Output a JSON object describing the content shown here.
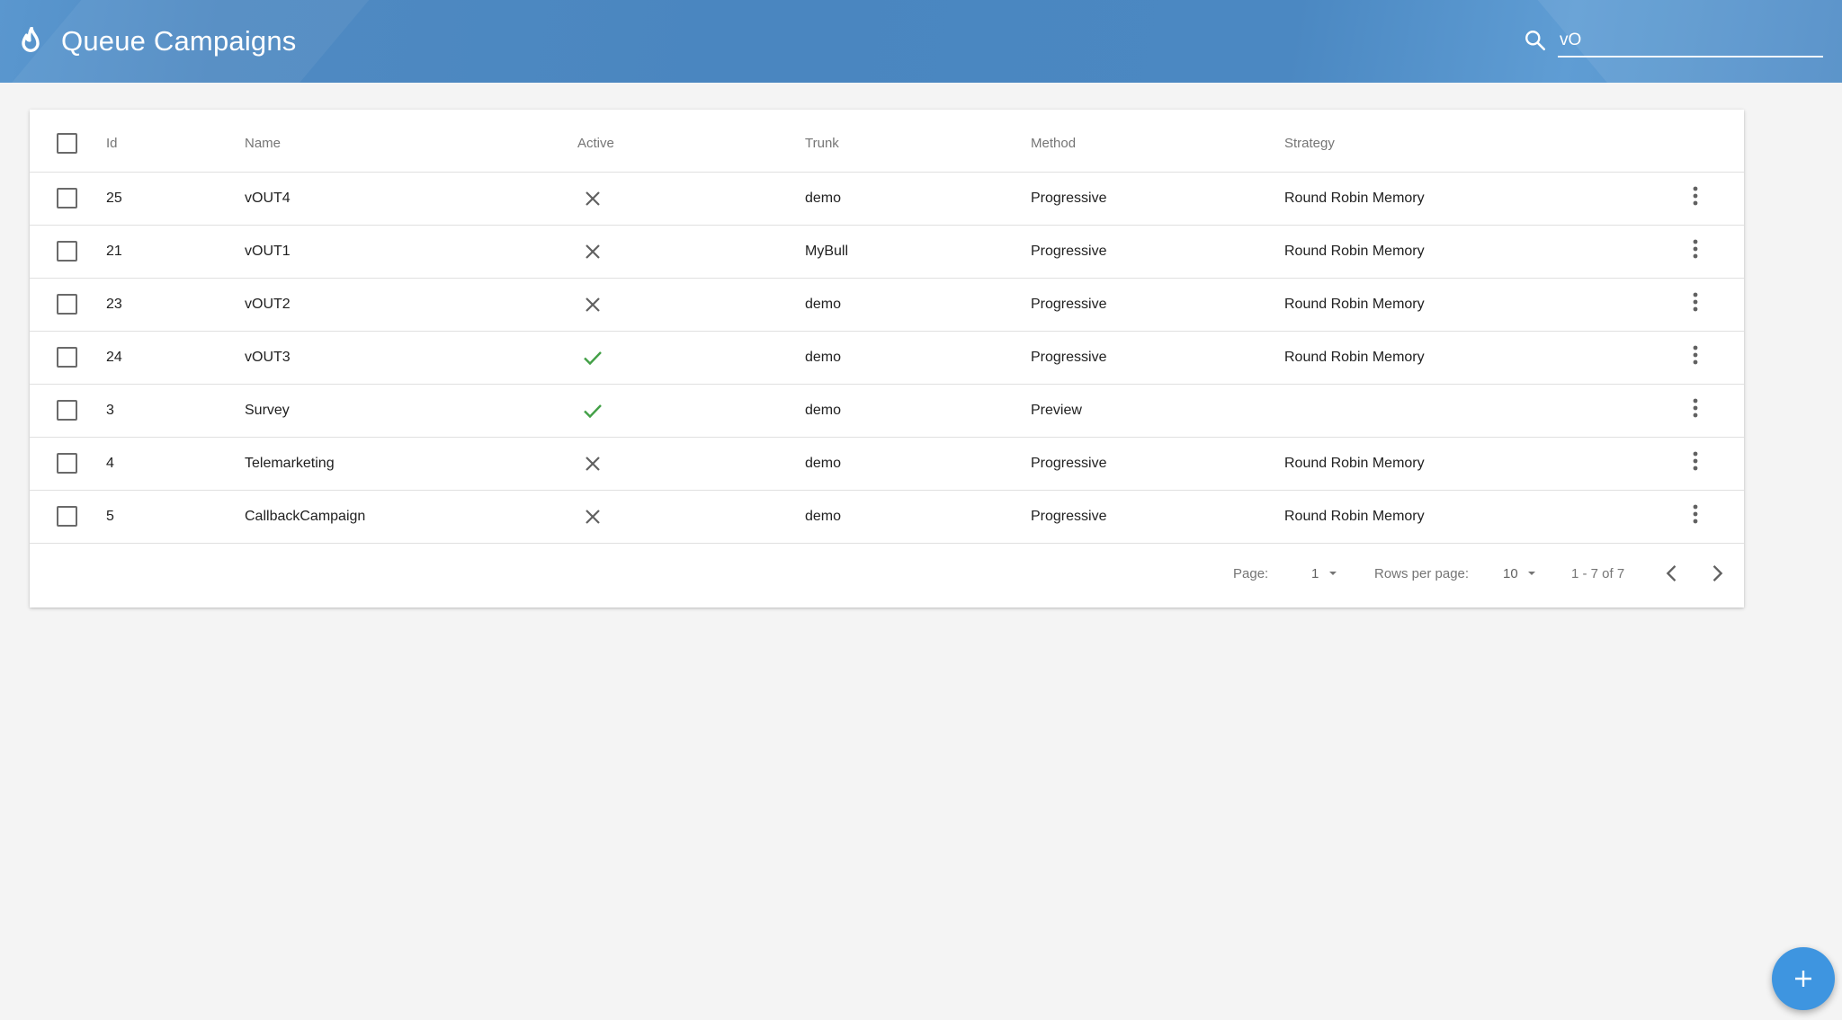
{
  "header": {
    "title": "Queue Campaigns",
    "search_value": "vO"
  },
  "table": {
    "columns": [
      "Id",
      "Name",
      "Active",
      "Trunk",
      "Method",
      "Strategy"
    ],
    "rows": [
      {
        "id": "25",
        "name": "vOUT4",
        "active": false,
        "trunk": "demo",
        "method": "Progressive",
        "strategy": "Round Robin Memory"
      },
      {
        "id": "21",
        "name": "vOUT1",
        "active": false,
        "trunk": "MyBull",
        "method": "Progressive",
        "strategy": "Round Robin Memory"
      },
      {
        "id": "23",
        "name": "vOUT2",
        "active": false,
        "trunk": "demo",
        "method": "Progressive",
        "strategy": "Round Robin Memory"
      },
      {
        "id": "24",
        "name": "vOUT3",
        "active": true,
        "trunk": "demo",
        "method": "Progressive",
        "strategy": "Round Robin Memory"
      },
      {
        "id": "3",
        "name": "Survey",
        "active": true,
        "trunk": "demo",
        "method": "Preview",
        "strategy": ""
      },
      {
        "id": "4",
        "name": "Telemarketing",
        "active": false,
        "trunk": "demo",
        "method": "Progressive",
        "strategy": "Round Robin Memory"
      },
      {
        "id": "5",
        "name": "CallbackCampaign",
        "active": false,
        "trunk": "demo",
        "method": "Progressive",
        "strategy": "Round Robin Memory"
      }
    ]
  },
  "pagination": {
    "page_label": "Page:",
    "page_value": "1",
    "rows_label": "Rows per page:",
    "rows_value": "10",
    "range": "1 - 7 of 7"
  },
  "colors": {
    "header": "#4a86c0",
    "fab": "#3e95e0",
    "active_check": "#43a047",
    "inactive_x": "#616161"
  },
  "icons": {
    "logo": "flame-icon",
    "search": "search-icon",
    "row_menu": "more-vert-icon",
    "active": "check-icon",
    "inactive": "close-icon",
    "prev": "chevron-left-icon",
    "next": "chevron-right-icon",
    "fab": "plus-icon"
  }
}
